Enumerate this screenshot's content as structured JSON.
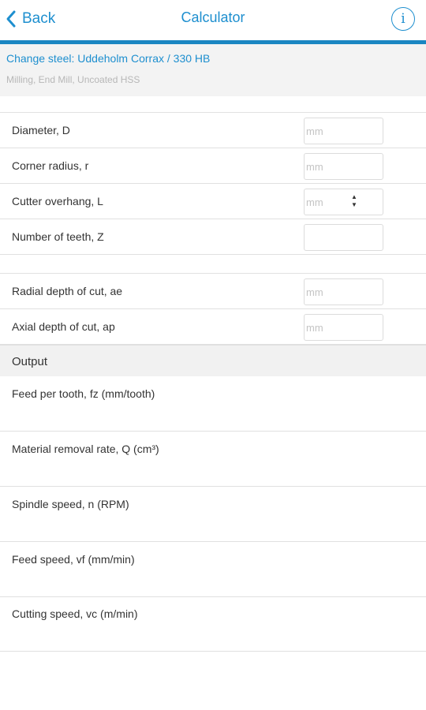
{
  "nav": {
    "back_label": "Back",
    "title": "Calculator",
    "info_glyph": "i"
  },
  "material": {
    "link": "Change steel: Uddeholm Corrax / 330 HB",
    "subtitle": "Milling, End Mill, Uncoated HSS"
  },
  "inputs": [
    {
      "label": "Diameter, D",
      "placeholder": "mm",
      "value": ""
    },
    {
      "label": "Corner radius, r",
      "placeholder": "mm",
      "value": ""
    },
    {
      "label": "Cutter overhang, L",
      "placeholder": "mm",
      "value": ""
    },
    {
      "label": "Number of teeth, Z",
      "placeholder": "",
      "value": ""
    }
  ],
  "depth_inputs": [
    {
      "label": "Radial depth of cut, ae",
      "placeholder": "mm",
      "value": ""
    },
    {
      "label": "Axial depth of cut, ap",
      "placeholder": "mm",
      "value": ""
    }
  ],
  "output": {
    "header": "Output",
    "rows": [
      {
        "label": "Feed per tooth, fz (mm/tooth)",
        "value": ""
      },
      {
        "label": "Material removal rate, Q (cm³)",
        "value": ""
      },
      {
        "label": "Spindle speed, n (RPM)",
        "value": ""
      },
      {
        "label": "Feed speed, vf (mm/min)",
        "value": ""
      },
      {
        "label": "Cutting speed, vc (m/min)",
        "value": ""
      }
    ]
  },
  "stepper": {
    "up_glyph": "▲",
    "down_glyph": "▼"
  },
  "colors": {
    "accent": "#1e8fcf",
    "nav_rule": "#1a86c2",
    "muted": "#b7b7b7"
  }
}
